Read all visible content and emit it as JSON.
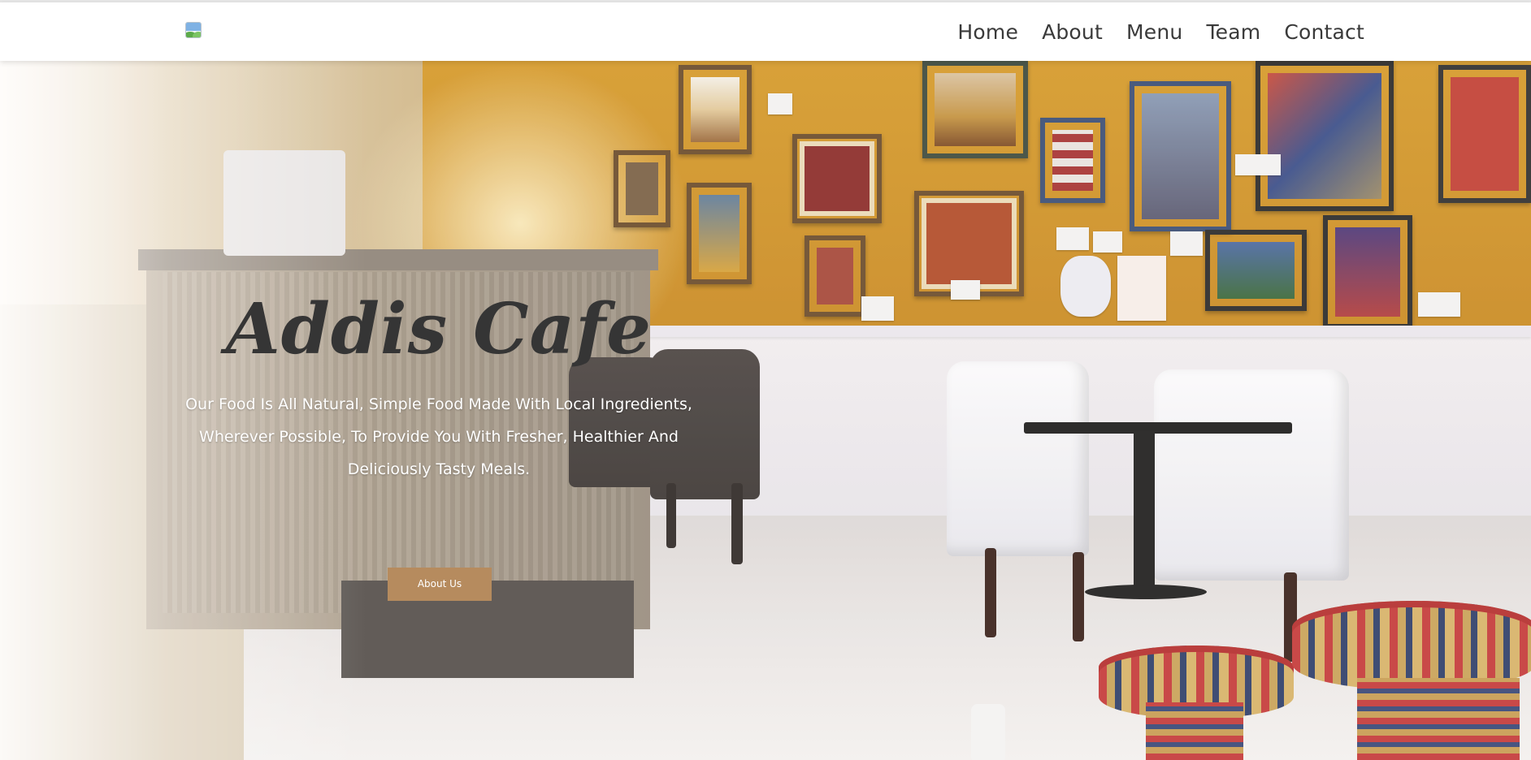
{
  "nav": {
    "logo_icon": "broken-image-icon",
    "items": [
      {
        "label": "Home"
      },
      {
        "label": "About"
      },
      {
        "label": "Menu"
      },
      {
        "label": "Team"
      },
      {
        "label": "Contact"
      }
    ]
  },
  "hero": {
    "title": "Addis Cafe",
    "subtitle": "Our Food Is All Natural, Simple Food Made With Local Ingredients, Wherever Possible, To Provide You With Fresher, Healthier And Deliciously Tasty Meals.",
    "button_label": "About Us",
    "background_description_icon": "cafe-interior-photo"
  },
  "colors": {
    "accent": "#b68b5e",
    "nav_text": "#3a3a3a",
    "title_text": "#353535",
    "subtitle_text": "#ffffff",
    "wall_yellow": "#d59a2b"
  }
}
